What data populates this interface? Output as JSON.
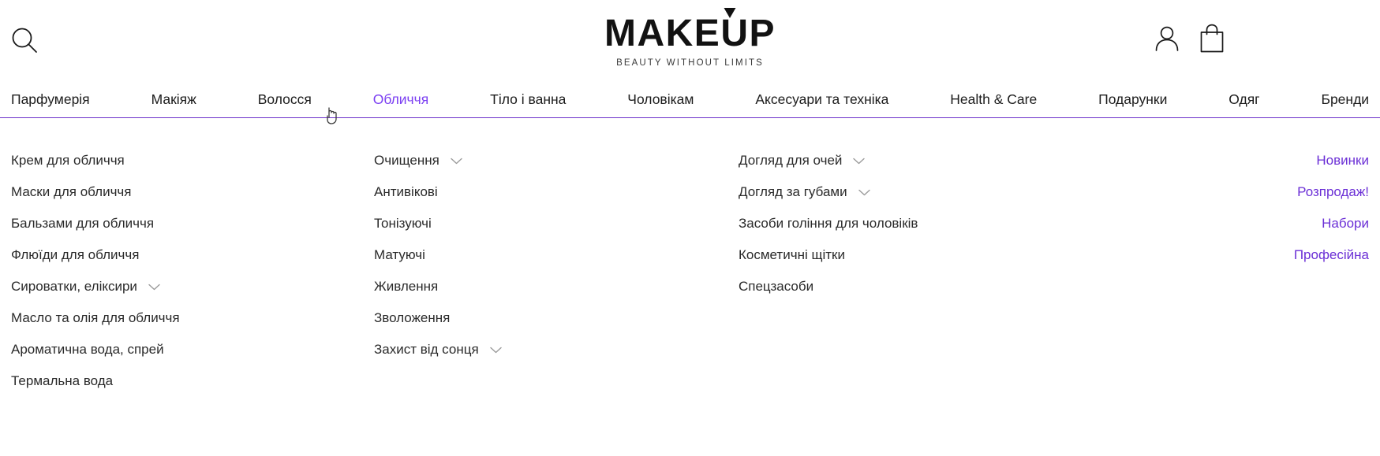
{
  "header": {
    "search_icon": "search-icon",
    "account_icon": "user-account-icon",
    "bag_icon": "shopping-bag-icon",
    "logo_text": "MAKEUP",
    "logo_tagline": "BEAUTY WITHOUT LIMITS"
  },
  "nav": {
    "active_index": 3,
    "accent_color": "#7b3ff2",
    "underline_color": "#6b30c9",
    "items": [
      {
        "label": "Парфумерія"
      },
      {
        "label": "Макіяж"
      },
      {
        "label": "Волосся"
      },
      {
        "label": "Обличчя"
      },
      {
        "label": "Тіло і ванна"
      },
      {
        "label": "Чоловікам"
      },
      {
        "label": "Аксесуари та техніка"
      },
      {
        "label": "Health & Care"
      },
      {
        "label": "Подарунки"
      },
      {
        "label": "Одяг"
      },
      {
        "label": "Бренди"
      }
    ]
  },
  "mega_menu": {
    "link_color": "#6b2fd6",
    "text_color": "#2a2a2a",
    "columns": [
      {
        "name": "face-care-products",
        "items": [
          {
            "label": "Крем для обличчя",
            "chevron": false
          },
          {
            "label": "Маски для обличчя",
            "chevron": false
          },
          {
            "label": "Бальзами для обличчя",
            "chevron": false
          },
          {
            "label": "Флюїди для обличчя",
            "chevron": false
          },
          {
            "label": "Сироватки, еліксири",
            "chevron": true
          },
          {
            "label": "Масло та олія для обличчя",
            "chevron": false
          },
          {
            "label": "Ароматична вода, спрей",
            "chevron": false
          },
          {
            "label": "Термальна вода",
            "chevron": false
          }
        ]
      },
      {
        "name": "treatment-types",
        "items": [
          {
            "label": "Очищення",
            "chevron": true
          },
          {
            "label": "Антивікові",
            "chevron": false
          },
          {
            "label": "Тонізуючі",
            "chevron": false
          },
          {
            "label": "Матуючі",
            "chevron": false
          },
          {
            "label": "Живлення",
            "chevron": false
          },
          {
            "label": "Зволоження",
            "chevron": false
          },
          {
            "label": "Захист від сонця",
            "chevron": true
          }
        ]
      },
      {
        "name": "specialized-care",
        "items": [
          {
            "label": "Догляд для очей",
            "chevron": true
          },
          {
            "label": "Догляд за губами",
            "chevron": true
          },
          {
            "label": "Засоби гоління для чоловіків",
            "chevron": false
          },
          {
            "label": "Косметичні щітки",
            "chevron": false
          },
          {
            "label": "Спецзасоби",
            "chevron": false
          }
        ]
      },
      {
        "name": "promo-links",
        "items": [
          {
            "label": "Новинки",
            "chevron": false
          },
          {
            "label": "Розпродаж!",
            "chevron": false
          },
          {
            "label": "Набори",
            "chevron": false
          },
          {
            "label": "Професійна",
            "chevron": false
          }
        ]
      }
    ]
  }
}
